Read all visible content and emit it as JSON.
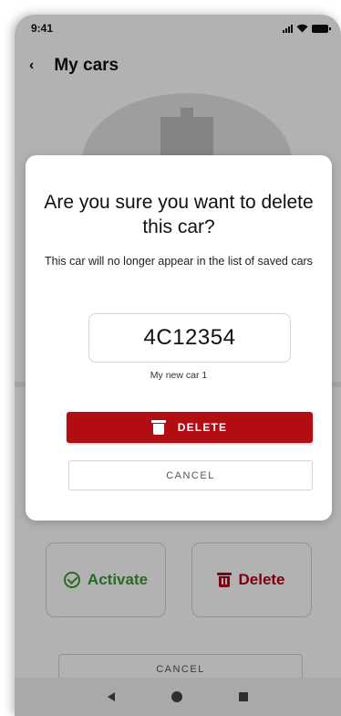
{
  "status_bar": {
    "time": "9:41"
  },
  "app_bar": {
    "title": "My cars"
  },
  "actions": {
    "activate_label": "Activate",
    "delete_label": "Delete",
    "cancel_label": "CANCEL"
  },
  "dialog": {
    "title": "Are you sure you want to delete this car?",
    "message": "This car will no longer appear in the list of saved cars",
    "plate": "4C12354",
    "car_name": "My new car 1",
    "delete_label": "DELETE",
    "cancel_label": "CANCEL"
  },
  "colors": {
    "danger": "#b10d12",
    "success": "#3c9a30"
  }
}
